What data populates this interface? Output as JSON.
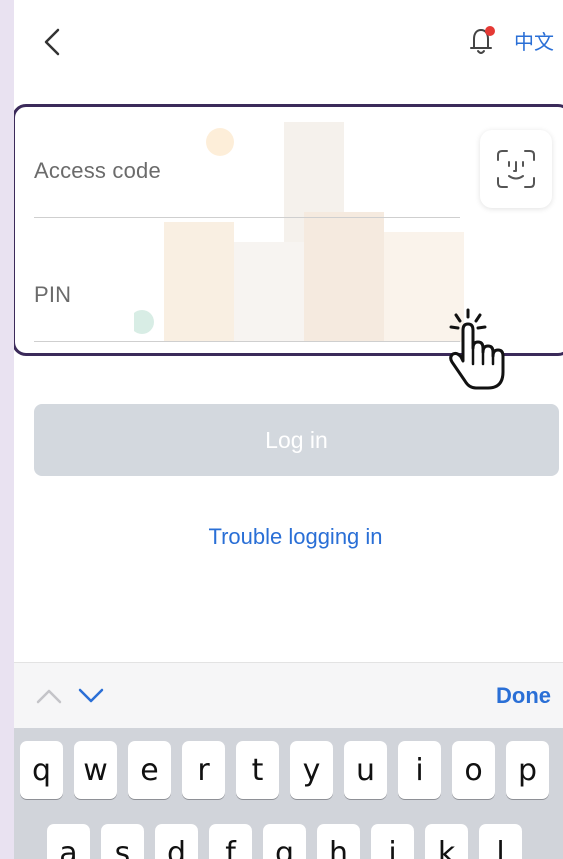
{
  "header": {
    "back_icon": "chevron-left-icon",
    "bell_icon": "bell-icon",
    "language_label": "中文"
  },
  "form": {
    "access_code_label": "Access code",
    "pin_label": "PIN",
    "face_id_icon": "face-id-icon"
  },
  "actions": {
    "login_label": "Log in",
    "trouble_label": "Trouble logging in"
  },
  "keyboard_toolbar": {
    "done_label": "Done"
  },
  "keyboard": {
    "row1": [
      "q",
      "w",
      "e",
      "r",
      "t",
      "y",
      "u",
      "i",
      "o",
      "p"
    ],
    "row2": [
      "a",
      "s",
      "d",
      "f",
      "g",
      "h",
      "j",
      "k",
      "l"
    ]
  },
  "colors": {
    "accent": "#2a6fd6",
    "button_disabled": "#d3d8de",
    "highlight_border": "#3b2a5a",
    "notification_dot": "#e53935"
  }
}
